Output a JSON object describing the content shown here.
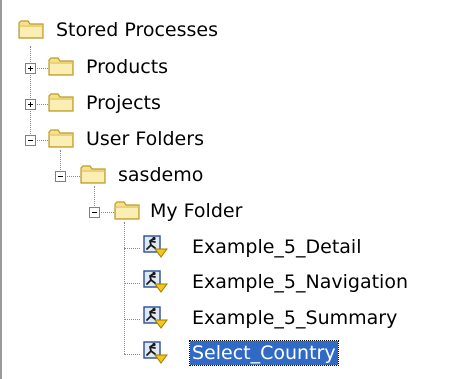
{
  "tree": {
    "root": {
      "label": "Stored Processes",
      "icon": "folder-icon",
      "expanded": true
    },
    "products": {
      "label": "Products",
      "icon": "folder-icon",
      "expanded": false
    },
    "projects": {
      "label": "Projects",
      "icon": "folder-icon",
      "expanded": false
    },
    "user_folders": {
      "label": "User Folders",
      "icon": "folder-icon",
      "expanded": true
    },
    "sasdemo": {
      "label": "sasdemo",
      "icon": "folder-icon",
      "expanded": true
    },
    "my_folder": {
      "label": "My Folder",
      "icon": "folder-icon",
      "expanded": true
    },
    "processes": [
      {
        "label": "Example_5_Detail",
        "icon": "stored-process-icon",
        "selected": false
      },
      {
        "label": "Example_5_Navigation",
        "icon": "stored-process-icon",
        "selected": false
      },
      {
        "label": "Example_5_Summary",
        "icon": "stored-process-icon",
        "selected": false
      },
      {
        "label": "Select_Country",
        "icon": "stored-process-icon",
        "selected": true
      }
    ]
  },
  "colors": {
    "folder_fill": "#f6e08a",
    "folder_stroke": "#b89a2c",
    "selection": "#316ac5",
    "tree_lines": "#8a8a8a"
  }
}
